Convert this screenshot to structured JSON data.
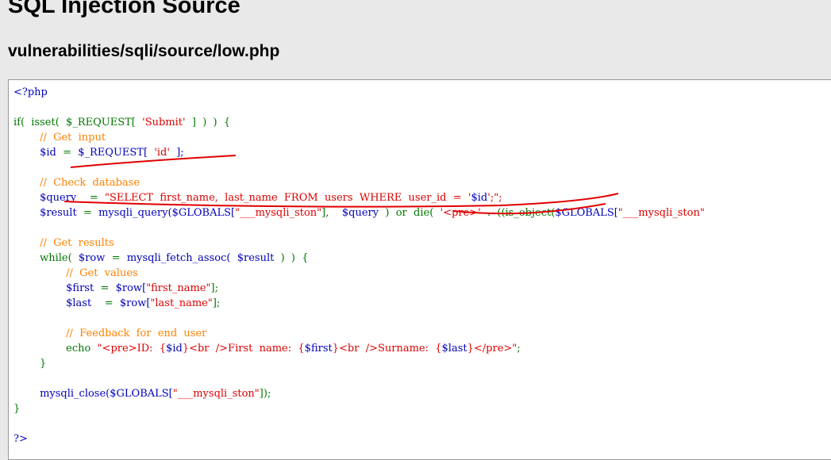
{
  "page": {
    "title": "SQL Injection Source",
    "subtitle": "vulnerabilities/sqli/source/low.php"
  },
  "source": {
    "lines": [
      [
        {
          "t": "<?php",
          "c": "var"
        }
      ],
      [],
      [
        {
          "t": "if(  isset(  $_REQUEST[  ",
          "c": "kw"
        },
        {
          "t": "'Submit'",
          "c": "str"
        },
        {
          "t": "  ]  )  )  {",
          "c": "kw"
        }
      ],
      [
        {
          "t": "        ",
          "c": "plain"
        },
        {
          "t": "//  Get  input",
          "c": "cm"
        }
      ],
      [
        {
          "t": "        ",
          "c": "plain"
        },
        {
          "t": "$id  ",
          "c": "var"
        },
        {
          "t": "=  ",
          "c": "kw"
        },
        {
          "t": "$_REQUEST[  ",
          "c": "var"
        },
        {
          "t": "'id'",
          "c": "str"
        },
        {
          "t": "  ];",
          "c": "var"
        }
      ],
      [],
      [
        {
          "t": "        ",
          "c": "plain"
        },
        {
          "t": "//  Check  database",
          "c": "cm"
        }
      ],
      [
        {
          "t": "        ",
          "c": "plain"
        },
        {
          "t": "$query    ",
          "c": "var"
        },
        {
          "t": "=  ",
          "c": "kw"
        },
        {
          "t": "\"SELECT  first_name,  last_name  FROM  users  WHERE  user_id  =  '",
          "c": "str"
        },
        {
          "t": "$id",
          "c": "var"
        },
        {
          "t": "';\";",
          "c": "str"
        }
      ],
      [
        {
          "t": "        ",
          "c": "plain"
        },
        {
          "t": "$result  ",
          "c": "var"
        },
        {
          "t": "=  ",
          "c": "kw"
        },
        {
          "t": "mysqli_query(",
          "c": "var"
        },
        {
          "t": "$GLOBALS[",
          "c": "var"
        },
        {
          "t": "\"___mysqli_ston\"",
          "c": "str"
        },
        {
          "t": "],    ",
          "c": "kw"
        },
        {
          "t": "$query  ",
          "c": "var"
        },
        {
          "t": ")  or  die(  ",
          "c": "kw"
        },
        {
          "t": "'<pre>'  ",
          "c": "str"
        },
        {
          "t": ".  ((is_object(",
          "c": "kw"
        },
        {
          "t": "$GLOBALS[",
          "c": "var"
        },
        {
          "t": "\"___mysqli_ston\"",
          "c": "str"
        }
      ],
      [],
      [
        {
          "t": "        ",
          "c": "plain"
        },
        {
          "t": "//  Get  results",
          "c": "cm"
        }
      ],
      [
        {
          "t": "        ",
          "c": "plain"
        },
        {
          "t": "while(  ",
          "c": "kw"
        },
        {
          "t": "$row  ",
          "c": "var"
        },
        {
          "t": "=  ",
          "c": "kw"
        },
        {
          "t": "mysqli_fetch_assoc(  ",
          "c": "var"
        },
        {
          "t": "$result  ",
          "c": "var"
        },
        {
          "t": ")  )  {",
          "c": "kw"
        }
      ],
      [
        {
          "t": "                ",
          "c": "plain"
        },
        {
          "t": "//  Get  values",
          "c": "cm"
        }
      ],
      [
        {
          "t": "                ",
          "c": "plain"
        },
        {
          "t": "$first  ",
          "c": "var"
        },
        {
          "t": "=  ",
          "c": "kw"
        },
        {
          "t": "$row[",
          "c": "var"
        },
        {
          "t": "\"first_name\"",
          "c": "str"
        },
        {
          "t": "];",
          "c": "kw"
        }
      ],
      [
        {
          "t": "                ",
          "c": "plain"
        },
        {
          "t": "$last    ",
          "c": "var"
        },
        {
          "t": "=  ",
          "c": "kw"
        },
        {
          "t": "$row[",
          "c": "var"
        },
        {
          "t": "\"last_name\"",
          "c": "str"
        },
        {
          "t": "];",
          "c": "kw"
        }
      ],
      [],
      [
        {
          "t": "                ",
          "c": "plain"
        },
        {
          "t": "//  Feedback  for  end  user",
          "c": "cm"
        }
      ],
      [
        {
          "t": "                ",
          "c": "plain"
        },
        {
          "t": "echo  ",
          "c": "kw"
        },
        {
          "t": "\"<pre>ID:  {",
          "c": "str"
        },
        {
          "t": "$id",
          "c": "var"
        },
        {
          "t": "}<br  />First  name:  {",
          "c": "str"
        },
        {
          "t": "$first",
          "c": "var"
        },
        {
          "t": "}<br  />Surname:  {",
          "c": "str"
        },
        {
          "t": "$last",
          "c": "var"
        },
        {
          "t": "}</pre>\"",
          "c": "str"
        },
        {
          "t": ";",
          "c": "kw"
        }
      ],
      [
        {
          "t": "        }",
          "c": "kw"
        }
      ],
      [],
      [
        {
          "t": "        ",
          "c": "plain"
        },
        {
          "t": "mysqli_close(",
          "c": "var"
        },
        {
          "t": "$GLOBALS[",
          "c": "var"
        },
        {
          "t": "\"___mysqli_ston\"",
          "c": "str"
        },
        {
          "t": "]);",
          "c": "kw"
        }
      ],
      [
        {
          "t": "}",
          "c": "kw"
        }
      ],
      [],
      [
        {
          "t": "?>",
          "c": "var"
        }
      ]
    ]
  },
  "annotation_color": "#e00000"
}
